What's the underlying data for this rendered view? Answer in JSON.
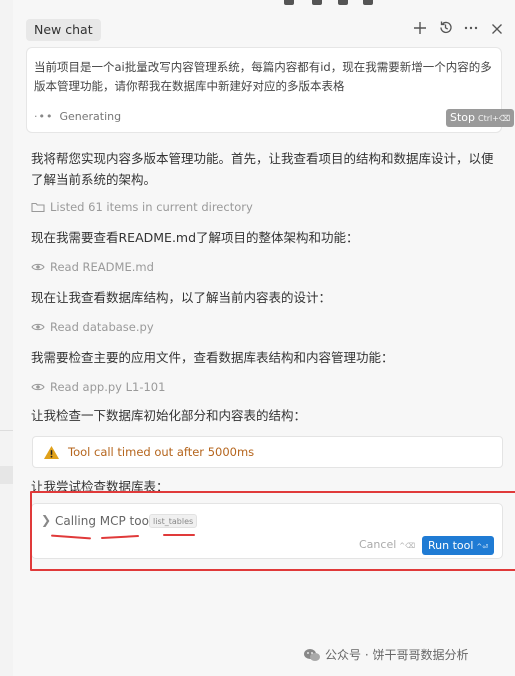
{
  "header": {
    "tab_title": "New chat",
    "icons": [
      "plus-icon",
      "history-icon",
      "more-icon",
      "close-icon"
    ]
  },
  "prompt": {
    "text": "当前项目是一个ai批量改写内容管理系统，每篇内容都有id，现在我需要新增一个内容的多版本管理功能，请你帮我在数据库中新建好对应的多版本表格",
    "status": "Generating",
    "stop_label": "Stop",
    "stop_shortcut": "Ctrl+⌫"
  },
  "messages": [
    {
      "type": "text",
      "text": "我将帮您实现内容多版本管理功能。首先，让我查看项目的结构和数据库设计，以便了解当前系统的架构。"
    },
    {
      "type": "step",
      "icon": "folder-icon",
      "text": "Listed 61 items in current directory"
    },
    {
      "type": "text",
      "text": "现在我需要查看README.md了解项目的整体架构和功能："
    },
    {
      "type": "step",
      "icon": "eye-icon",
      "text": "Read README.md"
    },
    {
      "type": "text",
      "text": "现在让我查看数据库结构，以了解当前内容表的设计："
    },
    {
      "type": "step",
      "icon": "eye-icon",
      "text": "Read database.py"
    },
    {
      "type": "text",
      "text": "我需要检查主要的应用文件，查看数据库表结构和内容管理功能："
    },
    {
      "type": "step",
      "icon": "eye-icon",
      "text": "Read app.py L1-101"
    },
    {
      "type": "text",
      "text": "让我检查一下数据库初始化部分和内容表的结构："
    },
    {
      "type": "warning",
      "icon": "warning-icon",
      "text": "Tool call timed out after 5000ms"
    },
    {
      "type": "text",
      "text": "让我尝试检查数据库表："
    }
  ],
  "mcp_call": {
    "title": "Calling MCP tool",
    "tool_name": "list_tables",
    "cancel_label": "Cancel",
    "cancel_shortcut": "^⌫",
    "run_label": "Run tool",
    "run_shortcut": "^⏎"
  },
  "watermark": {
    "text": "公众号 · 饼干哥哥数据分析"
  },
  "colors": {
    "accent": "#1f7bd4",
    "annotation_red": "#e03a3a",
    "warning_amber": "#e0a11b",
    "panel_bg": "#f7f7f7"
  }
}
